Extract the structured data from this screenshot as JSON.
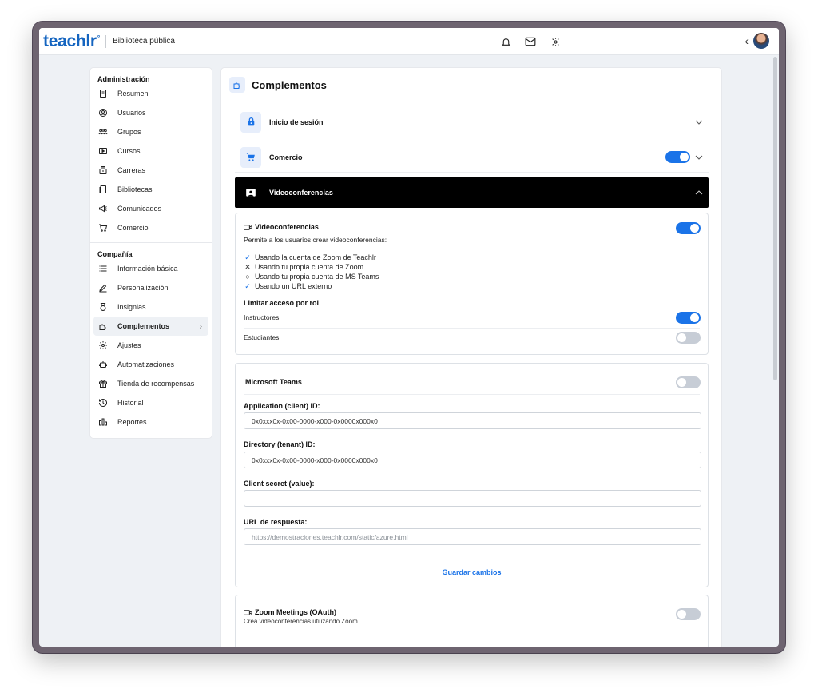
{
  "topbar": {
    "logo": "teachlr",
    "logo_mark": "°",
    "site_name": "Biblioteca pública",
    "icons": [
      "bell-icon",
      "mail-icon",
      "gear-icon"
    ],
    "back_glyph": "‹"
  },
  "sidebar": {
    "sections": [
      {
        "title": "Administración",
        "items": [
          {
            "label": "Resumen",
            "icon": "document-icon"
          },
          {
            "label": "Usuarios",
            "icon": "user-circle-icon"
          },
          {
            "label": "Grupos",
            "icon": "group-icon"
          },
          {
            "label": "Cursos",
            "icon": "play-box-icon"
          },
          {
            "label": "Carreras",
            "icon": "stack-icon"
          },
          {
            "label": "Bibliotecas",
            "icon": "library-icon"
          },
          {
            "label": "Comunicados",
            "icon": "megaphone-icon"
          },
          {
            "label": "Comercio",
            "icon": "cart-icon"
          }
        ]
      },
      {
        "title": "Compañía",
        "items": [
          {
            "label": "Información básica",
            "icon": "list-icon"
          },
          {
            "label": "Personalización",
            "icon": "pen-icon"
          },
          {
            "label": "Insignias",
            "icon": "medal-icon"
          },
          {
            "label": "Complementos",
            "icon": "puzzle-icon",
            "active": true
          },
          {
            "label": "Ajustes",
            "icon": "gear-icon"
          },
          {
            "label": "Automatizaciones",
            "icon": "robot-icon"
          },
          {
            "label": "Tienda de recompensas",
            "icon": "gift-icon"
          },
          {
            "label": "Historial",
            "icon": "history-icon"
          },
          {
            "label": "Reportes",
            "icon": "chart-icon"
          }
        ]
      }
    ]
  },
  "main": {
    "title": "Complementos",
    "accordions": {
      "login": {
        "label": "Inicio de sesión",
        "icon": "lock-icon"
      },
      "commerce": {
        "label": "Comercio",
        "icon": "cart-icon",
        "enabled": true
      },
      "video": {
        "label": "Videoconferencias",
        "icon": "video-icon",
        "expanded": true
      }
    },
    "video_panel": {
      "title": "Videoconferencias",
      "enabled": true,
      "description": "Permite a los usuarios crear videoconferencias:",
      "options": [
        {
          "mark": "✓",
          "label": "Usando la cuenta de Zoom de Teachlr",
          "state": "check"
        },
        {
          "mark": "✕",
          "label": "Usando tu propia cuenta de Zoom",
          "state": "cross"
        },
        {
          "mark": "○",
          "label": "Usando tu propia cuenta de MS Teams",
          "state": "circle"
        },
        {
          "mark": "✓",
          "label": "Usando un URL externo",
          "state": "check"
        }
      ],
      "limit_title": "Limitar acceso por rol",
      "roles": [
        {
          "label": "Instructores",
          "enabled": true
        },
        {
          "label": "Estudiantes",
          "enabled": false
        }
      ]
    },
    "teams_panel": {
      "title": "Microsoft Teams",
      "enabled": false,
      "fields": [
        {
          "label": "Application (client) ID:",
          "value": "0x0xxx0x-0x00-0000-x000-0x0000x000x0",
          "placeholder": ""
        },
        {
          "label": "Directory (tenant) ID:",
          "value": "0x0xxx0x-0x00-0000-x000-0x0000x000x0",
          "placeholder": ""
        },
        {
          "label": "Client secret (value):",
          "value": "",
          "placeholder": ""
        },
        {
          "label": "URL de respuesta:",
          "value": "",
          "placeholder": "https://demostraciones.teachlr.com/static/azure.html"
        }
      ],
      "save_label": "Guardar cambios"
    },
    "zoom_panel": {
      "title": "Zoom Meetings (OAuth)",
      "subtitle": "Crea videoconferencias utilizando Zoom.",
      "enabled": false
    }
  },
  "colors": {
    "accent": "#1a73e8",
    "brand": "#1565c0",
    "toggle_off": "#c7cdd6",
    "dark_row": "#000000"
  }
}
